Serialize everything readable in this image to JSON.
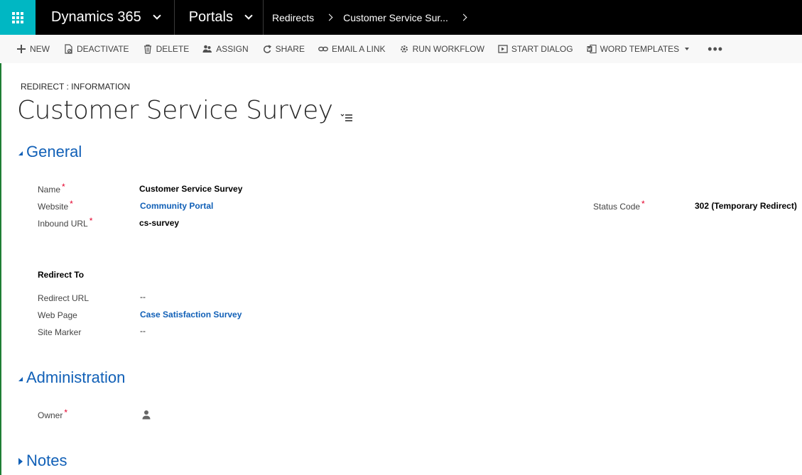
{
  "topbar": {
    "app_name": "Dynamics 365",
    "area_name": "Portals",
    "breadcrumbs": [
      "Redirects",
      "Customer Service Sur..."
    ]
  },
  "commands": [
    {
      "label": "NEW",
      "icon": "plus-icon"
    },
    {
      "label": "DEACTIVATE",
      "icon": "deactivate-icon"
    },
    {
      "label": "DELETE",
      "icon": "trash-icon"
    },
    {
      "label": "ASSIGN",
      "icon": "assign-icon"
    },
    {
      "label": "SHARE",
      "icon": "share-icon"
    },
    {
      "label": "EMAIL A LINK",
      "icon": "link-icon"
    },
    {
      "label": "RUN WORKFLOW",
      "icon": "workflow-icon"
    },
    {
      "label": "START DIALOG",
      "icon": "dialog-icon"
    },
    {
      "label": "WORD TEMPLATES",
      "icon": "word-icon"
    }
  ],
  "record": {
    "entity_label": "REDIRECT : INFORMATION",
    "title": "Customer Service Survey"
  },
  "sections": {
    "general": "General",
    "administration": "Administration",
    "notes": "Notes"
  },
  "general": {
    "name_label": "Name",
    "name_value": "Customer Service Survey",
    "website_label": "Website",
    "website_value": "Community Portal",
    "inbound_label": "Inbound URL",
    "inbound_value": "cs-survey",
    "status_label": "Status Code",
    "status_value": "302 (Temporary Redirect)",
    "redirect_to_heading": "Redirect To",
    "redirect_url_label": "Redirect URL",
    "redirect_url_value": "--",
    "web_page_label": "Web Page",
    "web_page_value": "Case Satisfaction Survey",
    "site_marker_label": "Site Marker",
    "site_marker_value": "--"
  },
  "administration": {
    "owner_label": "Owner"
  },
  "required_marker": "*",
  "colors": {
    "topbar": "#000000",
    "waffle": "#00b7c3",
    "link": "#1160b7",
    "required": "#e4002b"
  }
}
